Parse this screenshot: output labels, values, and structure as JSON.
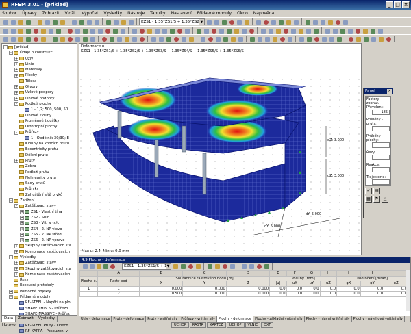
{
  "app": {
    "title": "RFEM 3.01 - [priklad]"
  },
  "menu": [
    "Soubor",
    "Úpravy",
    "Zobrazit",
    "Vložit",
    "Výpočet",
    "Výsledky",
    "Nástroje",
    "Tabulky",
    "Nastavení",
    "Přídavné moduly",
    "Okno",
    "Nápověda"
  ],
  "toolbar": {
    "load_combo": "KZS1 - 1.35*ZS1/S + 1.35*ZS2/S",
    "table_combo": "KZS1 - 1.35*ZS1/S + 1"
  },
  "navigator": {
    "items": [
      {
        "label": "[priklad]",
        "level": 0,
        "exp": "-",
        "kind": "folder"
      },
      {
        "label": "Údaje o konstrukci",
        "level": 1,
        "exp": "-",
        "kind": "folder"
      },
      {
        "label": "Uzly",
        "level": 2,
        "exp": "+",
        "kind": "folder"
      },
      {
        "label": "Linie",
        "level": 2,
        "exp": "+",
        "kind": "folder"
      },
      {
        "label": "Materiály",
        "level": 2,
        "exp": "+",
        "kind": "folder"
      },
      {
        "label": "Plochy",
        "level": 2,
        "exp": "+",
        "kind": "folder"
      },
      {
        "label": "Tělesa",
        "level": 2,
        "exp": "",
        "kind": "folder"
      },
      {
        "label": "Otvory",
        "level": 2,
        "exp": "+",
        "kind": "folder"
      },
      {
        "label": "Uzlové podpory",
        "level": 2,
        "exp": "+",
        "kind": "folder"
      },
      {
        "label": "Liniové podpory",
        "level": 2,
        "exp": "+",
        "kind": "folder"
      },
      {
        "label": "Podloží plochy",
        "level": 2,
        "exp": "-",
        "kind": "folder"
      },
      {
        "label": "1 - 1,2; 500, 500, 50",
        "level": 3,
        "exp": "",
        "kind": "item"
      },
      {
        "label": "Liniové klouby",
        "level": 2,
        "exp": "",
        "kind": "folder"
      },
      {
        "label": "Proměnné tloušťky",
        "level": 2,
        "exp": "",
        "kind": "folder"
      },
      {
        "label": "Ortotropní plochy",
        "level": 2,
        "exp": "",
        "kind": "folder"
      },
      {
        "label": "Průřezy",
        "level": 2,
        "exp": "-",
        "kind": "folder"
      },
      {
        "label": "1 - Obdélník 30/30; E",
        "level": 3,
        "exp": "",
        "kind": "item"
      },
      {
        "label": "Klouby na koncích prutu",
        "level": 2,
        "exp": "",
        "kind": "folder"
      },
      {
        "label": "Excentricity prutu",
        "level": 2,
        "exp": "",
        "kind": "folder"
      },
      {
        "label": "Dělení prutu",
        "level": 2,
        "exp": "",
        "kind": "folder"
      },
      {
        "label": "Pruty",
        "level": 2,
        "exp": "+",
        "kind": "folder"
      },
      {
        "label": "Žebra",
        "level": 2,
        "exp": "",
        "kind": "folder"
      },
      {
        "label": "Podloží prutu",
        "level": 2,
        "exp": "",
        "kind": "folder"
      },
      {
        "label": "Nelinearity prutu",
        "level": 2,
        "exp": "",
        "kind": "folder"
      },
      {
        "label": "Sady prutů",
        "level": 2,
        "exp": "",
        "kind": "folder"
      },
      {
        "label": "Průniky",
        "level": 2,
        "exp": "",
        "kind": "folder"
      },
      {
        "label": "Zahuštění sítě prvků",
        "level": 2,
        "exp": "",
        "kind": "folder"
      },
      {
        "label": "Zatížení",
        "level": 1,
        "exp": "-",
        "kind": "folder"
      },
      {
        "label": "Zatěžovací stavy",
        "level": 2,
        "exp": "-",
        "kind": "folder"
      },
      {
        "label": "ZS1 - Vlastní tíha",
        "level": 3,
        "exp": "+",
        "kind": "load"
      },
      {
        "label": "ZS2 - Sníh",
        "level": 3,
        "exp": "+",
        "kind": "load"
      },
      {
        "label": "ZS3 - Vítr v -x/c",
        "level": 3,
        "exp": "+",
        "kind": "load"
      },
      {
        "label": "ZS4 - 2. NP vlevo",
        "level": 3,
        "exp": "+",
        "kind": "load"
      },
      {
        "label": "ZS5 - 2. NP střed",
        "level": 3,
        "exp": "+",
        "kind": "load"
      },
      {
        "label": "ZS6 - 2. NP vpravo",
        "level": 3,
        "exp": "+",
        "kind": "load"
      },
      {
        "label": "Skupiny zatěžovacích sta",
        "level": 2,
        "exp": "+",
        "kind": "folder"
      },
      {
        "label": "Kombinace zatěžovacích",
        "level": 2,
        "exp": "+",
        "kind": "folder"
      },
      {
        "label": "Výsledky",
        "level": 1,
        "exp": "-",
        "kind": "folder"
      },
      {
        "label": "Zatěžovací stavy",
        "level": 2,
        "exp": "+",
        "kind": "folder"
      },
      {
        "label": "Skupiny zatěžovacích sta",
        "level": 2,
        "exp": "+",
        "kind": "folder"
      },
      {
        "label": "Kombinace zatěžovacích",
        "level": 2,
        "exp": "+",
        "kind": "folder"
      },
      {
        "label": "Řezy",
        "level": 1,
        "exp": "",
        "kind": "folder"
      },
      {
        "label": "Exekuční protokoly",
        "level": 1,
        "exp": "",
        "kind": "folder"
      },
      {
        "label": "Pomocné objekty",
        "level": 1,
        "exp": "+",
        "kind": "folder"
      },
      {
        "label": "Přídavné moduly",
        "level": 1,
        "exp": "-",
        "kind": "folder"
      },
      {
        "label": "RF-STEEL - Napětí na plo",
        "level": 2,
        "exp": "",
        "kind": "item"
      },
      {
        "label": "SHAPE THIN 6 - Průřezo",
        "level": 2,
        "exp": "",
        "kind": "item"
      },
      {
        "label": "SHAPE-MASSIVE - Průřez",
        "level": 2,
        "exp": "",
        "kind": "item"
      },
      {
        "label": "RF-STEEL Plochy - Obecr",
        "level": 2,
        "exp": "",
        "kind": "item"
      },
      {
        "label": "RF-STEEL Pruty - Obecn",
        "level": 2,
        "exp": "",
        "kind": "item"
      },
      {
        "label": "RF-KAPPA - Posouzení v",
        "level": 2,
        "exp": "",
        "kind": "item"
      }
    ],
    "tabs": [
      "Data",
      "Zobrazit",
      "Výsledky"
    ]
  },
  "viewport": {
    "info_line1": "Deformace u",
    "info_line2": "KZS1 - 1.35*ZS1/S + 1.35*ZS2/S + 1.35*ZS3/S + 1.35*ZS4/S + 1.35*ZS5/S + 1.35*ZS6/S",
    "footer": "Max u: 2.4, Min u: 0.0 mm",
    "dims": [
      "dZ: 3.000",
      "dZ: 3.000",
      "dY: 5.000",
      "dY: 5.000"
    ]
  },
  "panel": {
    "title": "Panel",
    "label_factors": "Faktory zobraz.",
    "label_exag": "Převelení:",
    "exag_value": "185",
    "label_rods": "Průběhy - pruty:",
    "label_surfaces": "Průběhy - plochy:",
    "label_sections": "Řezy:",
    "label_reactions": "Reakce:",
    "label_trajectories": "Trajektorie:"
  },
  "table": {
    "title": "4.9 Plochy - deformace",
    "letters": [
      "A",
      "B",
      "C",
      "D",
      "E",
      "F",
      "G",
      "H",
      "I",
      "J"
    ],
    "headers1": [
      "Plocha č.",
      "Rastr bod",
      "Souřadnice rastrového bodu [m]",
      "Posuny [mm]",
      "Pootočení [mrad]"
    ],
    "headers2": [
      "X",
      "Y",
      "Z",
      "|u|",
      "uX",
      "uY",
      "uZ",
      "φX",
      "φY",
      "φZ"
    ],
    "rows": [
      {
        "surface": "1",
        "point": "1",
        "x": "0.000",
        "y": "0.000",
        "z": "0.000",
        "u": "0.0",
        "ux": "0.0",
        "uy": "0.0",
        "uz": "0.0",
        "fx": "0.0",
        "fy": "0.0",
        "fz": "0.0"
      },
      {
        "surface": "",
        "point": "2",
        "x": "0.500",
        "y": "0.000",
        "z": "0.000",
        "u": "0.0",
        "ux": "0.0",
        "uy": "0.0",
        "uz": "0.0",
        "fx": "0.0",
        "fy": "0.0",
        "fz": "0.0"
      }
    ],
    "tabs": [
      "Uzly - deformace",
      "Pruty - deformace",
      "Pruty - vnitřní síly",
      "Průřezy - vnitřní síly",
      "Plochy - deformace",
      "Plochy - základní vnitřní síly",
      "Plochy - hlavní vnitřní síly",
      "Plochy - návrhové vnitřní síly"
    ]
  },
  "status": {
    "ready": "Hotovo",
    "buttons": [
      "UCHOP",
      "RASTR",
      "KARTEZ",
      "UCHOP",
      "VLNIE",
      "DXF"
    ]
  },
  "colors": {
    "title_bar": "#0a246a",
    "mesh": "#1a2aa0"
  }
}
